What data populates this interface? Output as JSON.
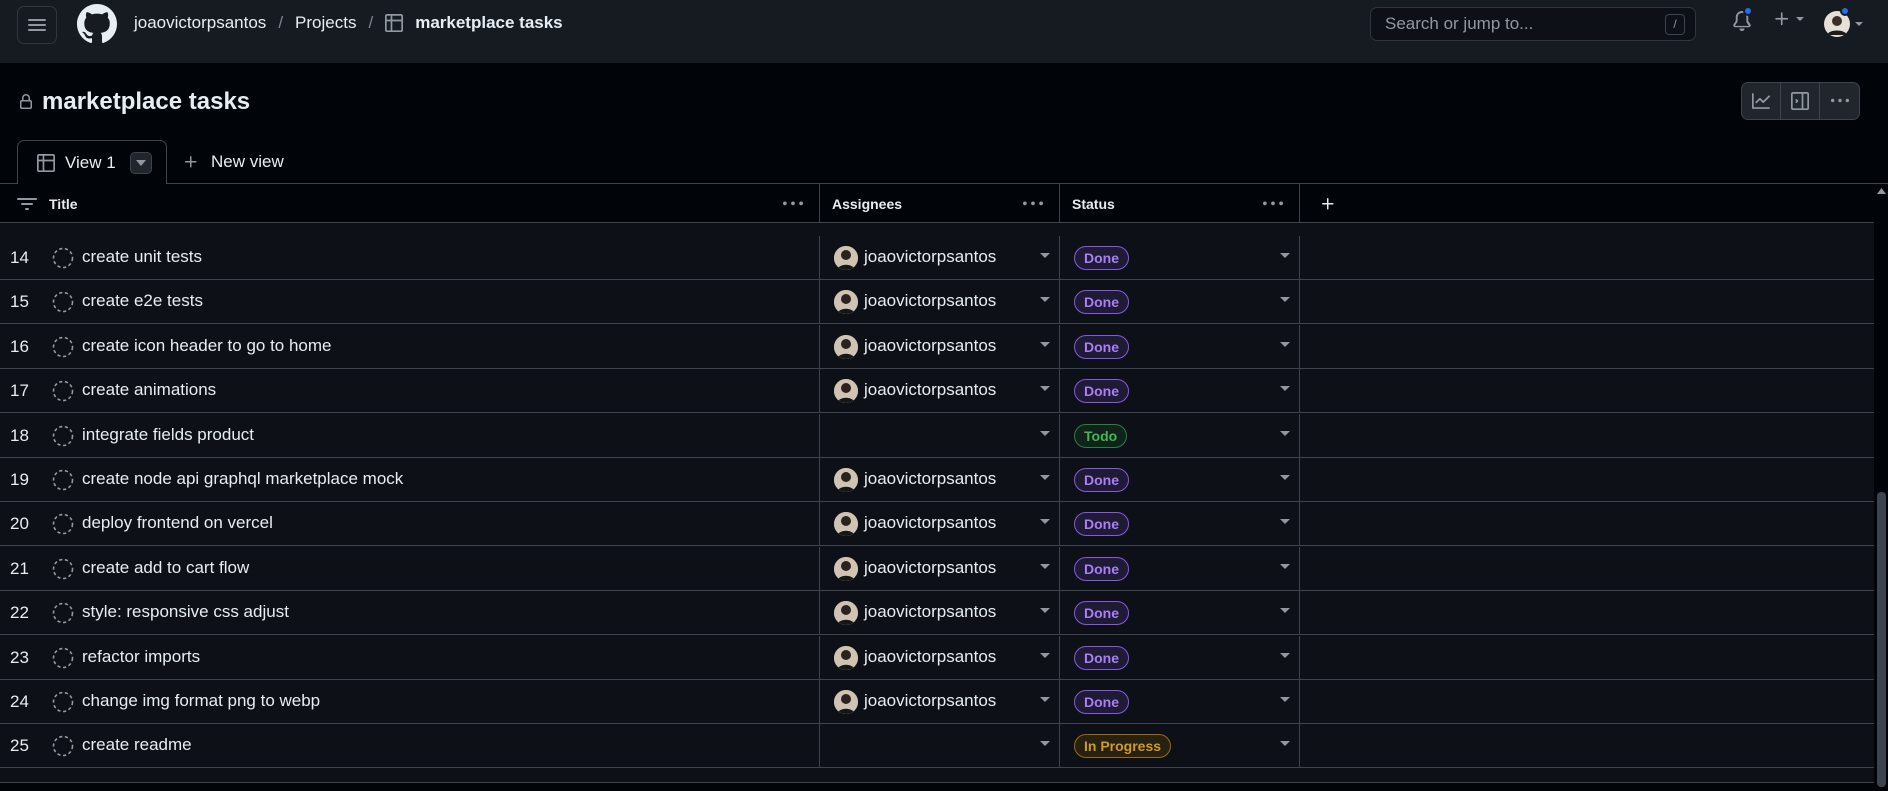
{
  "topbar": {
    "owner": "joaovictorpsantos",
    "projects": "Projects",
    "project_name": "marketplace tasks",
    "search_placeholder": "Search or jump to...",
    "search_key": "/"
  },
  "project": {
    "title": "marketplace tasks",
    "active_view": "View 1",
    "new_view": "New view"
  },
  "columns": {
    "title": "Title",
    "assignees": "Assignees",
    "status": "Status"
  },
  "rows": [
    {
      "num": "14",
      "title": "create unit tests",
      "assignee": "joaovictorpsantos",
      "status": "Done"
    },
    {
      "num": "15",
      "title": "create e2e tests",
      "assignee": "joaovictorpsantos",
      "status": "Done"
    },
    {
      "num": "16",
      "title": "create icon header to go to home",
      "assignee": "joaovictorpsantos",
      "status": "Done"
    },
    {
      "num": "17",
      "title": "create animations",
      "assignee": "joaovictorpsantos",
      "status": "Done"
    },
    {
      "num": "18",
      "title": "integrate fields product",
      "assignee": "",
      "status": "Todo"
    },
    {
      "num": "19",
      "title": "create node api graphql marketplace mock",
      "assignee": "joaovictorpsantos",
      "status": "Done"
    },
    {
      "num": "20",
      "title": "deploy frontend on vercel",
      "assignee": "joaovictorpsantos",
      "status": "Done"
    },
    {
      "num": "21",
      "title": "create add to cart flow",
      "assignee": "joaovictorpsantos",
      "status": "Done"
    },
    {
      "num": "22",
      "title": "style: responsive css adjust",
      "assignee": "joaovictorpsantos",
      "status": "Done"
    },
    {
      "num": "23",
      "title": "refactor imports",
      "assignee": "joaovictorpsantos",
      "status": "Done"
    },
    {
      "num": "24",
      "title": "change img format png to webp",
      "assignee": "joaovictorpsantos",
      "status": "Done"
    },
    {
      "num": "25",
      "title": "create readme",
      "assignee": "",
      "status": "In Progress"
    }
  ],
  "colors": {
    "done": "#8957e5",
    "todo": "#238636",
    "in_progress": "#9e6a03",
    "notification_dot": "#1f6feb"
  }
}
